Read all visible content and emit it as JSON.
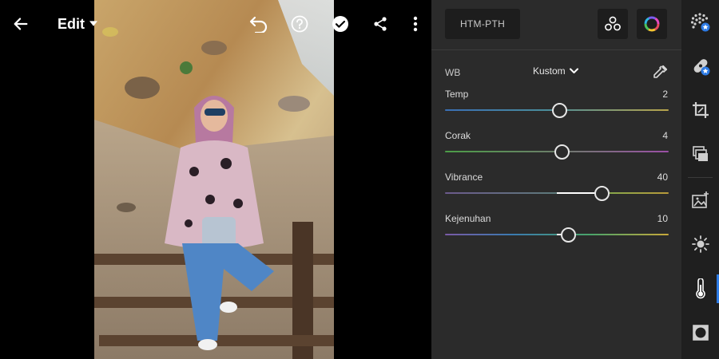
{
  "topbar": {
    "edit_label": "Edit",
    "icons": [
      "back-arrow-icon",
      "dropdown-caret-icon",
      "undo-icon",
      "help-icon",
      "done-check-icon",
      "share-icon",
      "more-vert-icon"
    ]
  },
  "panel": {
    "preset_label": "HTM-PTH",
    "wb": {
      "label": "WB",
      "selected": "Kustom"
    },
    "sliders": [
      {
        "label": "Temp",
        "value": "2",
        "level": 0.51
      },
      {
        "label": "Corak",
        "value": "4",
        "level": 0.52
      },
      {
        "label": "Vibrance",
        "value": "40",
        "level": 0.7
      },
      {
        "label": "Kejenuhan",
        "value": "10",
        "level": 0.55
      }
    ]
  },
  "rail": {
    "items": [
      "auto-icon",
      "healing-icon",
      "crop-icon",
      "presets-icon",
      "selective-icon",
      "light-icon",
      "color-icon",
      "vignette-icon"
    ],
    "active": "color-icon"
  },
  "colors": {
    "accent": "#2d7be5",
    "panel_bg": "#2b2b2b",
    "rail_bg": "#1f1f1f",
    "button_bg": "#1d1d1d"
  }
}
